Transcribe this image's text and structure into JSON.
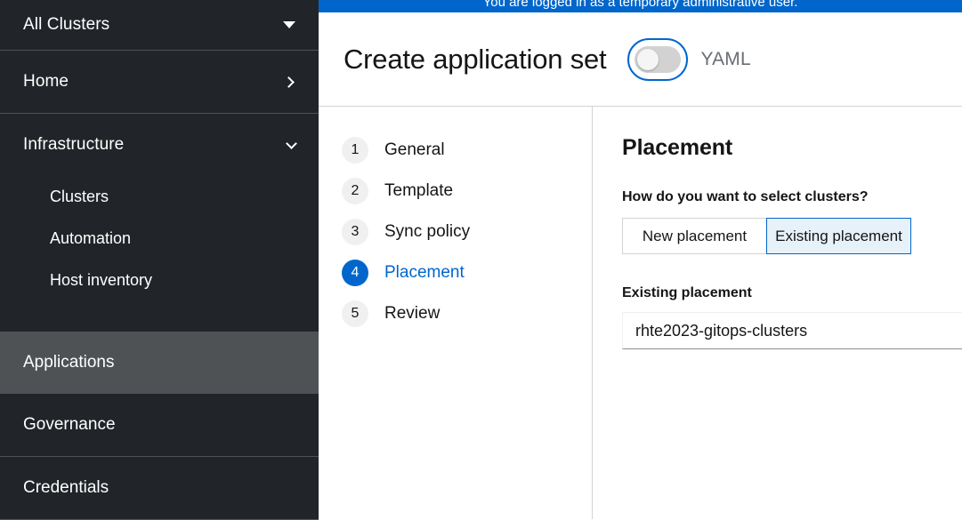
{
  "banner": {
    "text": "You are logged in as a temporary administrative user."
  },
  "sidebar": {
    "cluster_selector": {
      "label": "All Clusters",
      "icon": "caret-down-icon"
    },
    "home": {
      "label": "Home",
      "icon": "chevron-right-icon"
    },
    "infrastructure": {
      "label": "Infrastructure",
      "icon": "chevron-down-icon"
    },
    "infrastructure_children": [
      {
        "label": "Clusters"
      },
      {
        "label": "Automation"
      },
      {
        "label": "Host inventory"
      }
    ],
    "sections": [
      {
        "label": "Applications",
        "active": true
      },
      {
        "label": "Governance",
        "active": false
      },
      {
        "label": "Credentials",
        "active": false
      }
    ]
  },
  "header": {
    "title": "Create application set",
    "yaml_label": "YAML",
    "yaml_enabled": false
  },
  "wizard": {
    "steps": [
      {
        "number": "1",
        "label": "General"
      },
      {
        "number": "2",
        "label": "Template"
      },
      {
        "number": "3",
        "label": "Sync policy"
      },
      {
        "number": "4",
        "label": "Placement"
      },
      {
        "number": "5",
        "label": "Review"
      }
    ],
    "current_step": "4"
  },
  "content": {
    "title": "Placement",
    "question_label": "How do you want to select clusters?",
    "options": [
      {
        "label": "New placement",
        "selected": false
      },
      {
        "label": "Existing placement",
        "selected": true
      }
    ],
    "existing_placement_label": "Existing placement",
    "existing_placement_value": "rhte2023-gitops-clusters"
  },
  "colors": {
    "accent_blue": "#0066cc",
    "sidebar_bg": "#212529",
    "sidebar_active": "#4f5255",
    "selected_bg": "#e7f1fa"
  }
}
